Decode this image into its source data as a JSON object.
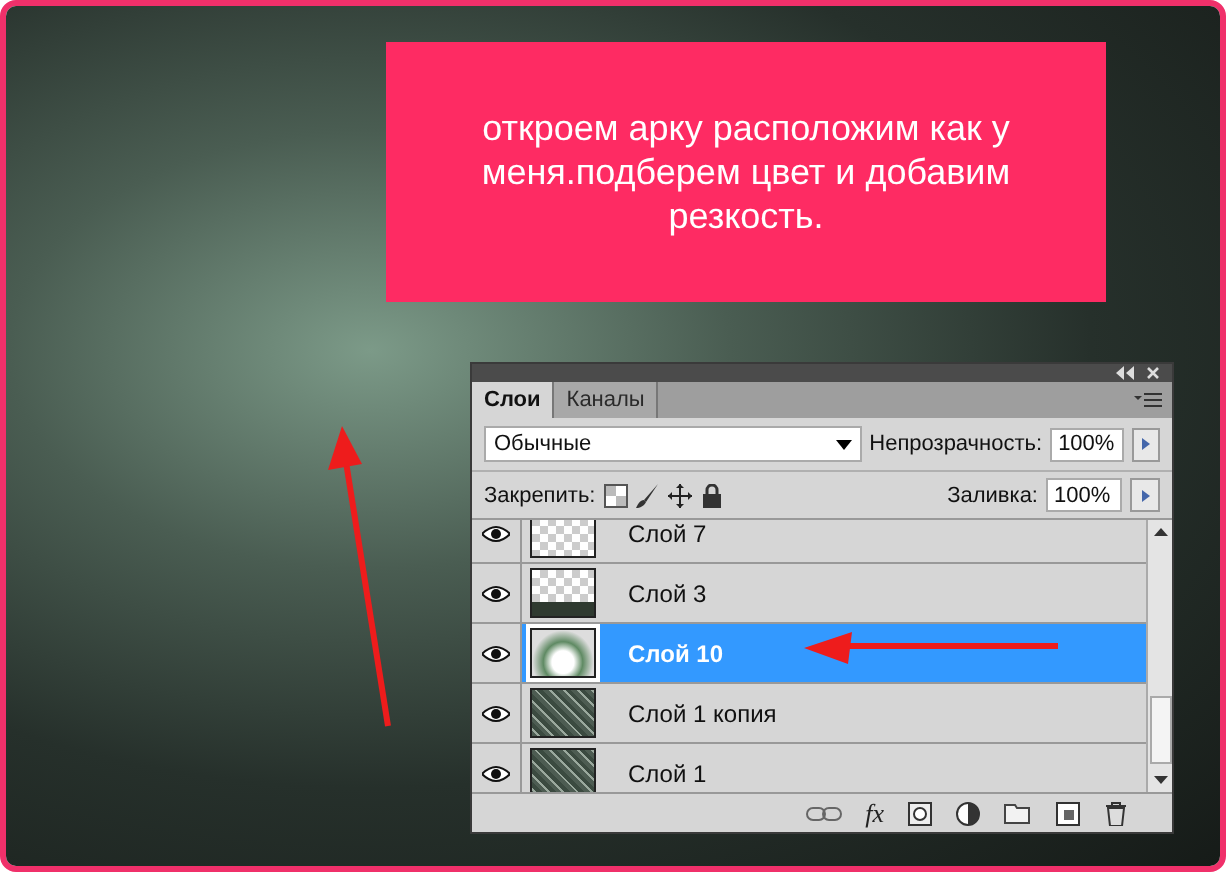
{
  "callout": {
    "text": "откроем арку расположим как у меня.подберем цвет и добавим резкость."
  },
  "layers_panel": {
    "tabs": [
      {
        "label": "Слои",
        "selected": true
      },
      {
        "label": "Каналы",
        "selected": false
      }
    ],
    "blend_mode": "Обычные",
    "opacity": {
      "label": "Непрозрачность:",
      "value": "100%"
    },
    "lock": {
      "label": "Закрепить:"
    },
    "fill": {
      "label": "Заливка:",
      "value": "100%"
    },
    "footer": {
      "fx_label": "fx"
    },
    "layers": [
      {
        "name": "Слой 7",
        "kind": "transparent",
        "visible": true,
        "selected": false
      },
      {
        "name": "Слой 3",
        "kind": "strip",
        "visible": true,
        "selected": false
      },
      {
        "name": "Слой 10",
        "kind": "arch",
        "visible": true,
        "selected": true
      },
      {
        "name": "Слой 1 копия",
        "kind": "texture",
        "visible": true,
        "selected": false
      },
      {
        "name": "Слой 1",
        "kind": "texture",
        "visible": true,
        "selected": false
      }
    ]
  }
}
